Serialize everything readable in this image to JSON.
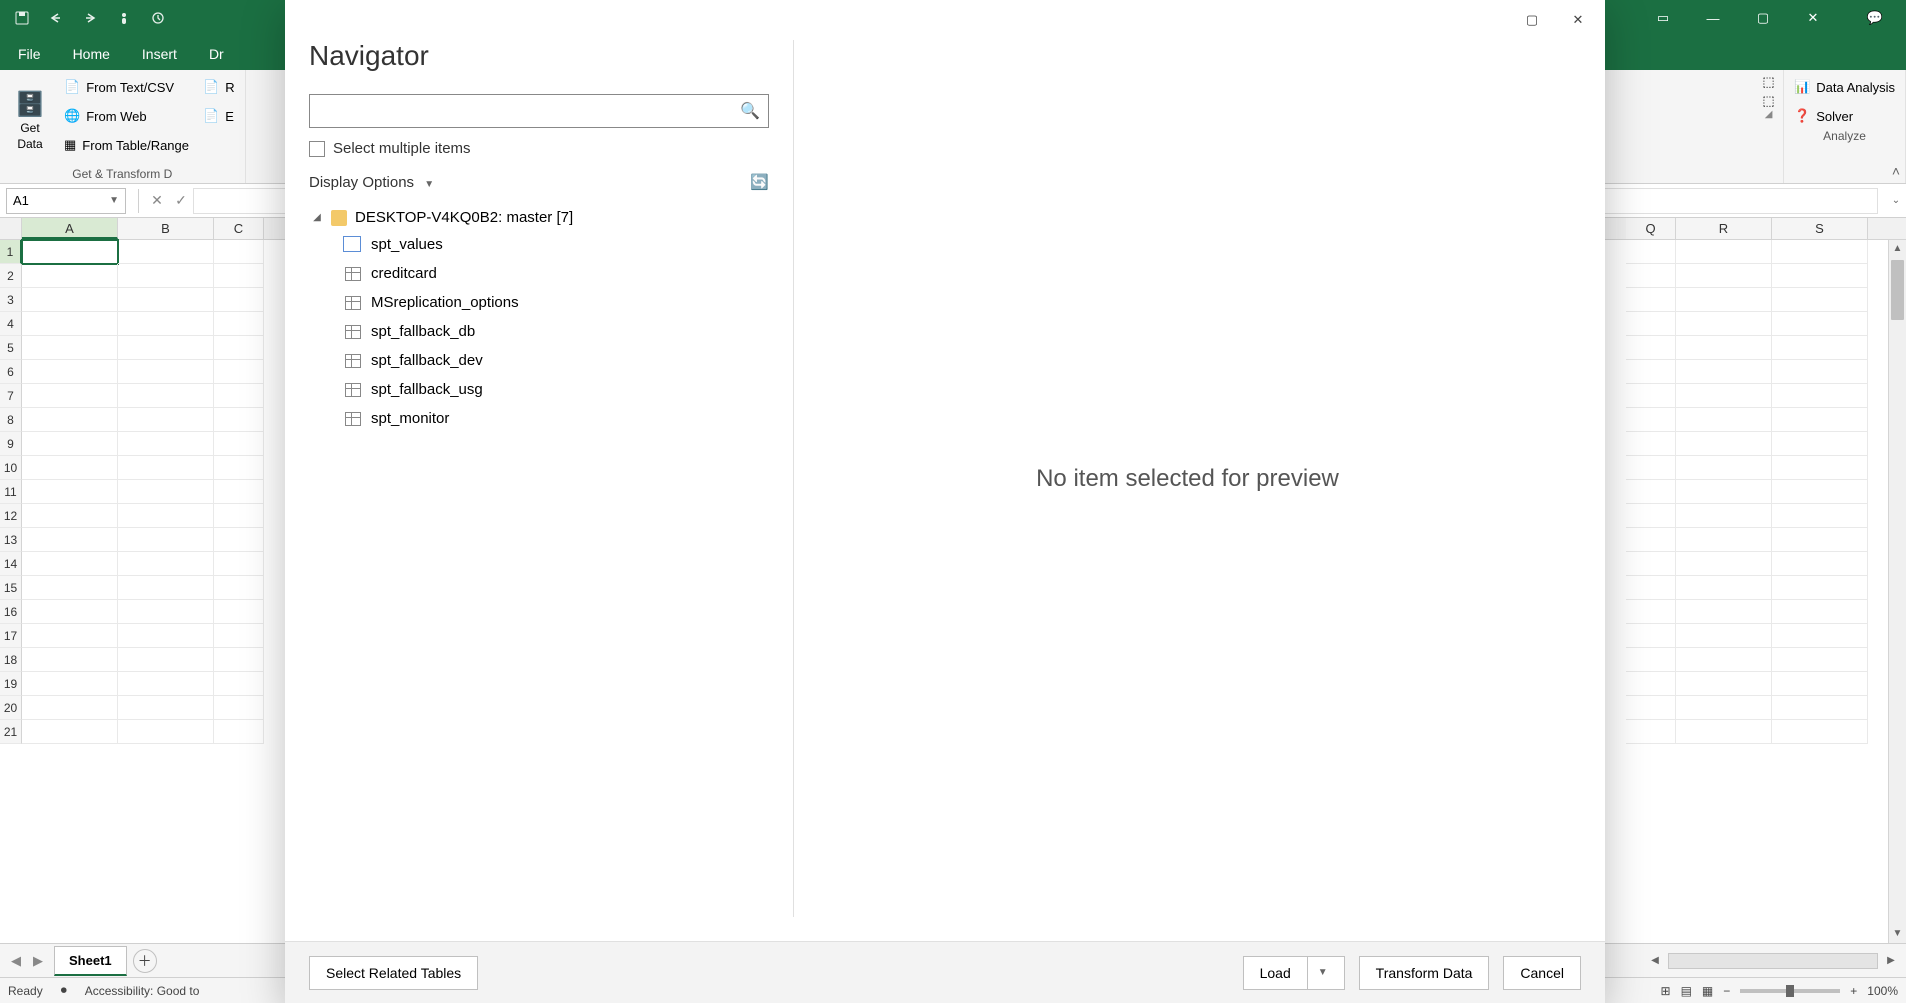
{
  "titlebar": {
    "win_controls": {
      "icon_min": "—",
      "icon_max": "▢",
      "icon_close": "✕",
      "icon_display": "▭",
      "icon_comment": "💬"
    }
  },
  "ribbon": {
    "tabs": [
      "File",
      "Home",
      "Insert",
      "Dr"
    ],
    "get_data": {
      "label_line1": "Get",
      "label_line2": "Data"
    },
    "from_text_csv": "From Text/CSV",
    "from_web": "From Web",
    "from_table_range": "From Table/Range",
    "partial_r": "R",
    "partial_e": "E",
    "group_get_transform": "Get & Transform D",
    "data_analysis": "Data Analysis",
    "solver": "Solver",
    "group_analyze": "Analyze"
  },
  "formula": {
    "name_box": "A1"
  },
  "grid": {
    "left_cols": [
      "A",
      "B",
      "C"
    ],
    "right_cols": [
      "Q",
      "R",
      "S"
    ],
    "rows": [
      1,
      2,
      3,
      4,
      5,
      6,
      7,
      8,
      9,
      10,
      11,
      12,
      13,
      14,
      15,
      16,
      17,
      18,
      19,
      20,
      21
    ]
  },
  "navigator": {
    "title": "Navigator",
    "search_placeholder": "",
    "select_multi": "Select multiple items",
    "display_options": "Display Options",
    "root_label": "DESKTOP-V4KQ0B2: master [7]",
    "items": [
      {
        "name": "spt_values",
        "kind": "view"
      },
      {
        "name": "creditcard",
        "kind": "table"
      },
      {
        "name": "MSreplication_options",
        "kind": "table"
      },
      {
        "name": "spt_fallback_db",
        "kind": "table"
      },
      {
        "name": "spt_fallback_dev",
        "kind": "table"
      },
      {
        "name": "spt_fallback_usg",
        "kind": "table"
      },
      {
        "name": "spt_monitor",
        "kind": "table"
      }
    ],
    "preview_empty": "No item selected for preview",
    "footer": {
      "select_related": "Select Related Tables",
      "load": "Load",
      "transform": "Transform Data",
      "cancel": "Cancel"
    }
  },
  "sheet_bar": {
    "tab1": "Sheet1"
  },
  "status": {
    "ready": "Ready",
    "accessibility": "Accessibility: Good to",
    "zoom": "100%"
  }
}
